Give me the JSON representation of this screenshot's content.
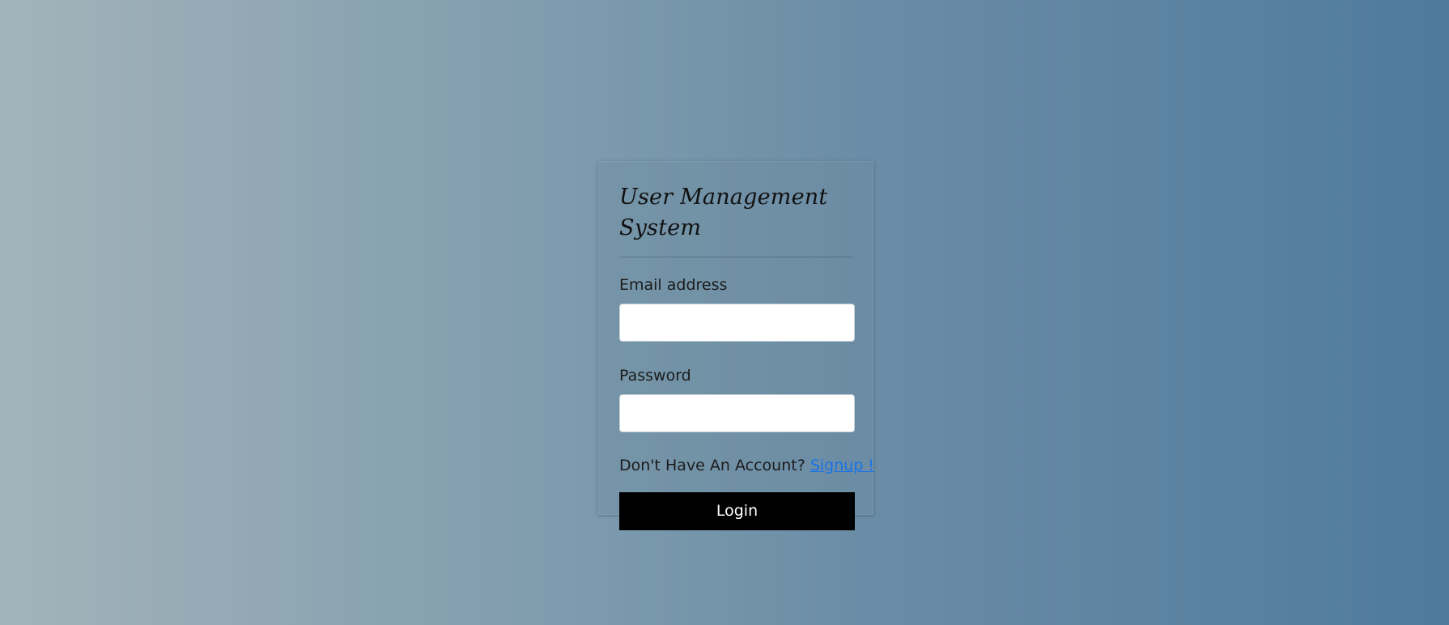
{
  "login_card": {
    "title": "User Management System",
    "email_label": "Email address",
    "email_value": "",
    "password_label": "Password",
    "password_value": "",
    "signup_prompt": "Don't Have An Account?",
    "signup_link": "Signup !",
    "login_button": "Login"
  },
  "colors": {
    "background_left": "#a3b3ba",
    "background_right": "#4f7a9c",
    "button": "#000000",
    "link": "#1a73e8"
  }
}
